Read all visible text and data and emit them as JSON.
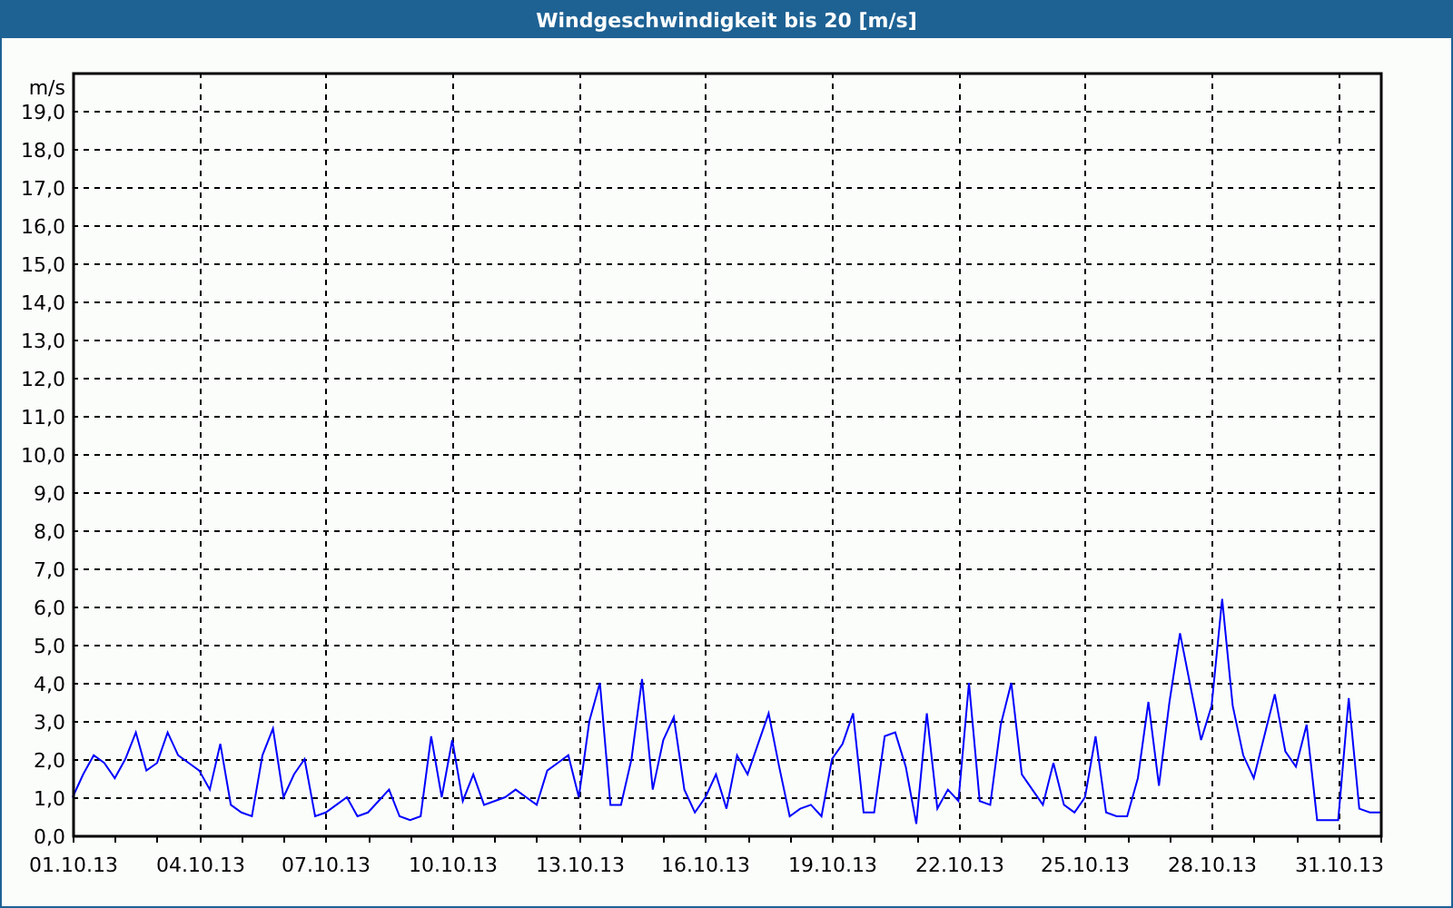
{
  "window": {
    "title": "Windgeschwindigkeit bis 20 [m/s]"
  },
  "chart": {
    "chart_data": {
      "type": "line",
      "grid": true,
      "ylabel": "m/s",
      "ylim": [
        0,
        20
      ],
      "yticks": [
        {
          "value": 0,
          "label": "0,0"
        },
        {
          "value": 1,
          "label": "1,0"
        },
        {
          "value": 2,
          "label": "2,0"
        },
        {
          "value": 3,
          "label": "3,0"
        },
        {
          "value": 4,
          "label": "4,0"
        },
        {
          "value": 5,
          "label": "5,0"
        },
        {
          "value": 6,
          "label": "6,0"
        },
        {
          "value": 7,
          "label": "7,0"
        },
        {
          "value": 8,
          "label": "8,0"
        },
        {
          "value": 9,
          "label": "9,0"
        },
        {
          "value": 10,
          "label": "10,0"
        },
        {
          "value": 11,
          "label": "11,0"
        },
        {
          "value": 12,
          "label": "12,0"
        },
        {
          "value": 13,
          "label": "13,0"
        },
        {
          "value": 14,
          "label": "14,0"
        },
        {
          "value": 15,
          "label": "15,0"
        },
        {
          "value": 16,
          "label": "16,0"
        },
        {
          "value": 17,
          "label": "17,0"
        },
        {
          "value": 18,
          "label": "18,0"
        },
        {
          "value": 19,
          "label": "19,0"
        }
      ],
      "categories": [
        "01.10.13",
        null,
        null,
        null,
        null,
        null,
        null,
        null,
        null,
        null,
        null,
        null,
        "04.10.13",
        null,
        null,
        null,
        null,
        null,
        null,
        null,
        null,
        null,
        null,
        null,
        "07.10.13",
        null,
        null,
        null,
        null,
        null,
        null,
        null,
        null,
        null,
        null,
        null,
        "10.10.13",
        null,
        null,
        null,
        null,
        null,
        null,
        null,
        null,
        null,
        null,
        null,
        "13.10.13",
        null,
        null,
        null,
        null,
        null,
        null,
        null,
        null,
        null,
        null,
        null,
        "16.10.13",
        null,
        null,
        null,
        null,
        null,
        null,
        null,
        null,
        null,
        null,
        null,
        "19.10.13",
        null,
        null,
        null,
        null,
        null,
        null,
        null,
        null,
        null,
        null,
        null,
        "22.10.13",
        null,
        null,
        null,
        null,
        null,
        null,
        null,
        null,
        null,
        null,
        null,
        "25.10.13",
        null,
        null,
        null,
        null,
        null,
        null,
        null,
        null,
        null,
        null,
        null,
        "28.10.13",
        null,
        null,
        null,
        null,
        null,
        null,
        null,
        null,
        null,
        null,
        null,
        "31.10.13",
        null,
        null,
        null,
        null
      ],
      "series": [
        {
          "color": "#0000ff",
          "values": [
            1.0,
            1.6,
            2.1,
            1.9,
            1.5,
            2.0,
            2.7,
            1.7,
            1.9,
            2.7,
            2.1,
            1.9,
            1.7,
            1.2,
            2.4,
            0.8,
            0.6,
            0.5,
            2.1,
            2.8,
            1.0,
            1.6,
            2.0,
            0.5,
            0.6,
            0.8,
            1.0,
            0.5,
            0.6,
            0.9,
            1.2,
            0.5,
            0.4,
            0.5,
            2.6,
            1.0,
            2.5,
            0.9,
            1.6,
            0.8,
            0.9,
            1.0,
            1.2,
            1.0,
            0.8,
            1.7,
            1.9,
            2.1,
            1.0,
            3.0,
            4.0,
            0.8,
            0.8,
            2.0,
            4.1,
            1.2,
            2.5,
            3.1,
            1.2,
            0.6,
            1.0,
            1.6,
            0.7,
            2.1,
            1.6,
            2.4,
            3.2,
            1.8,
            0.5,
            0.7,
            0.8,
            0.5,
            2.0,
            2.4,
            3.2,
            0.6,
            0.6,
            2.6,
            2.7,
            1.8,
            0.3,
            3.2,
            0.7,
            1.2,
            0.9,
            4.0,
            0.9,
            0.8,
            2.9,
            4.0,
            1.6,
            1.2,
            0.8,
            1.9,
            0.8,
            0.6,
            1.0,
            2.6,
            0.6,
            0.5,
            0.5,
            1.5,
            3.5,
            1.3,
            3.5,
            5.3,
            3.9,
            2.5,
            3.4,
            6.2,
            3.4,
            2.1,
            1.5,
            2.6,
            3.7,
            2.2,
            1.8,
            2.9,
            0.4,
            0.4,
            0.4,
            3.6,
            0.7,
            0.6,
            0.6
          ]
        }
      ]
    }
  }
}
